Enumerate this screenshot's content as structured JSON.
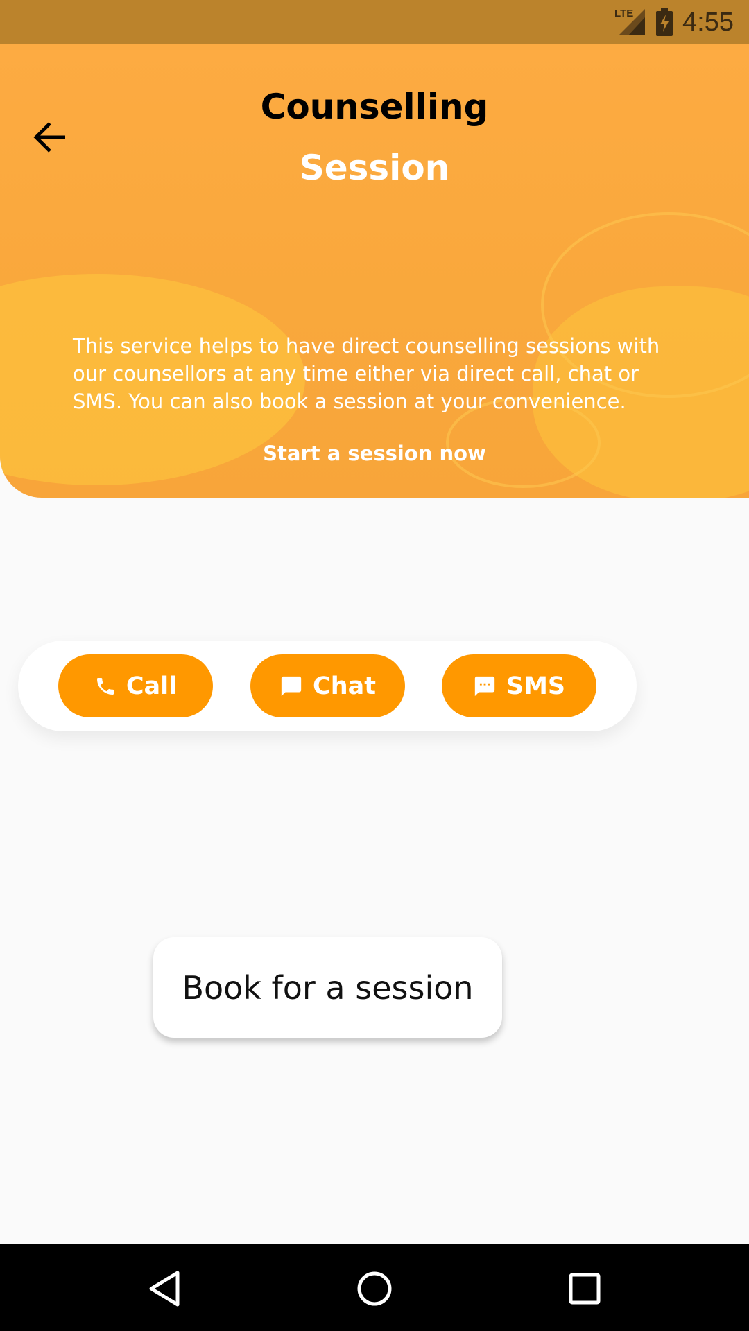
{
  "status_bar": {
    "time": "4:55",
    "network_label": "LTE",
    "icons": [
      "lte-signal-icon",
      "battery-charging-icon"
    ]
  },
  "header": {
    "title_line1": "Counselling",
    "title_line2": "Session",
    "description": "This service helps to have direct counselling sessions with our counsellors at any time either via direct call, chat or SMS. You can also book a session at your convenience.",
    "cta": "Start a session now",
    "back_icon": "arrow-back-icon"
  },
  "actions": {
    "call": {
      "label": "Call",
      "icon": "phone-icon"
    },
    "chat": {
      "label": "Chat",
      "icon": "chat-bubble-icon"
    },
    "sms": {
      "label": "SMS",
      "icon": "sms-icon"
    }
  },
  "book": {
    "label": "Book for a session"
  },
  "colors": {
    "accent": "#ff9800",
    "header": "#fdab42",
    "status_bar": "#bb832c"
  },
  "nav": {
    "icons": [
      "nav-back-icon",
      "nav-home-icon",
      "nav-recent-icon"
    ]
  }
}
